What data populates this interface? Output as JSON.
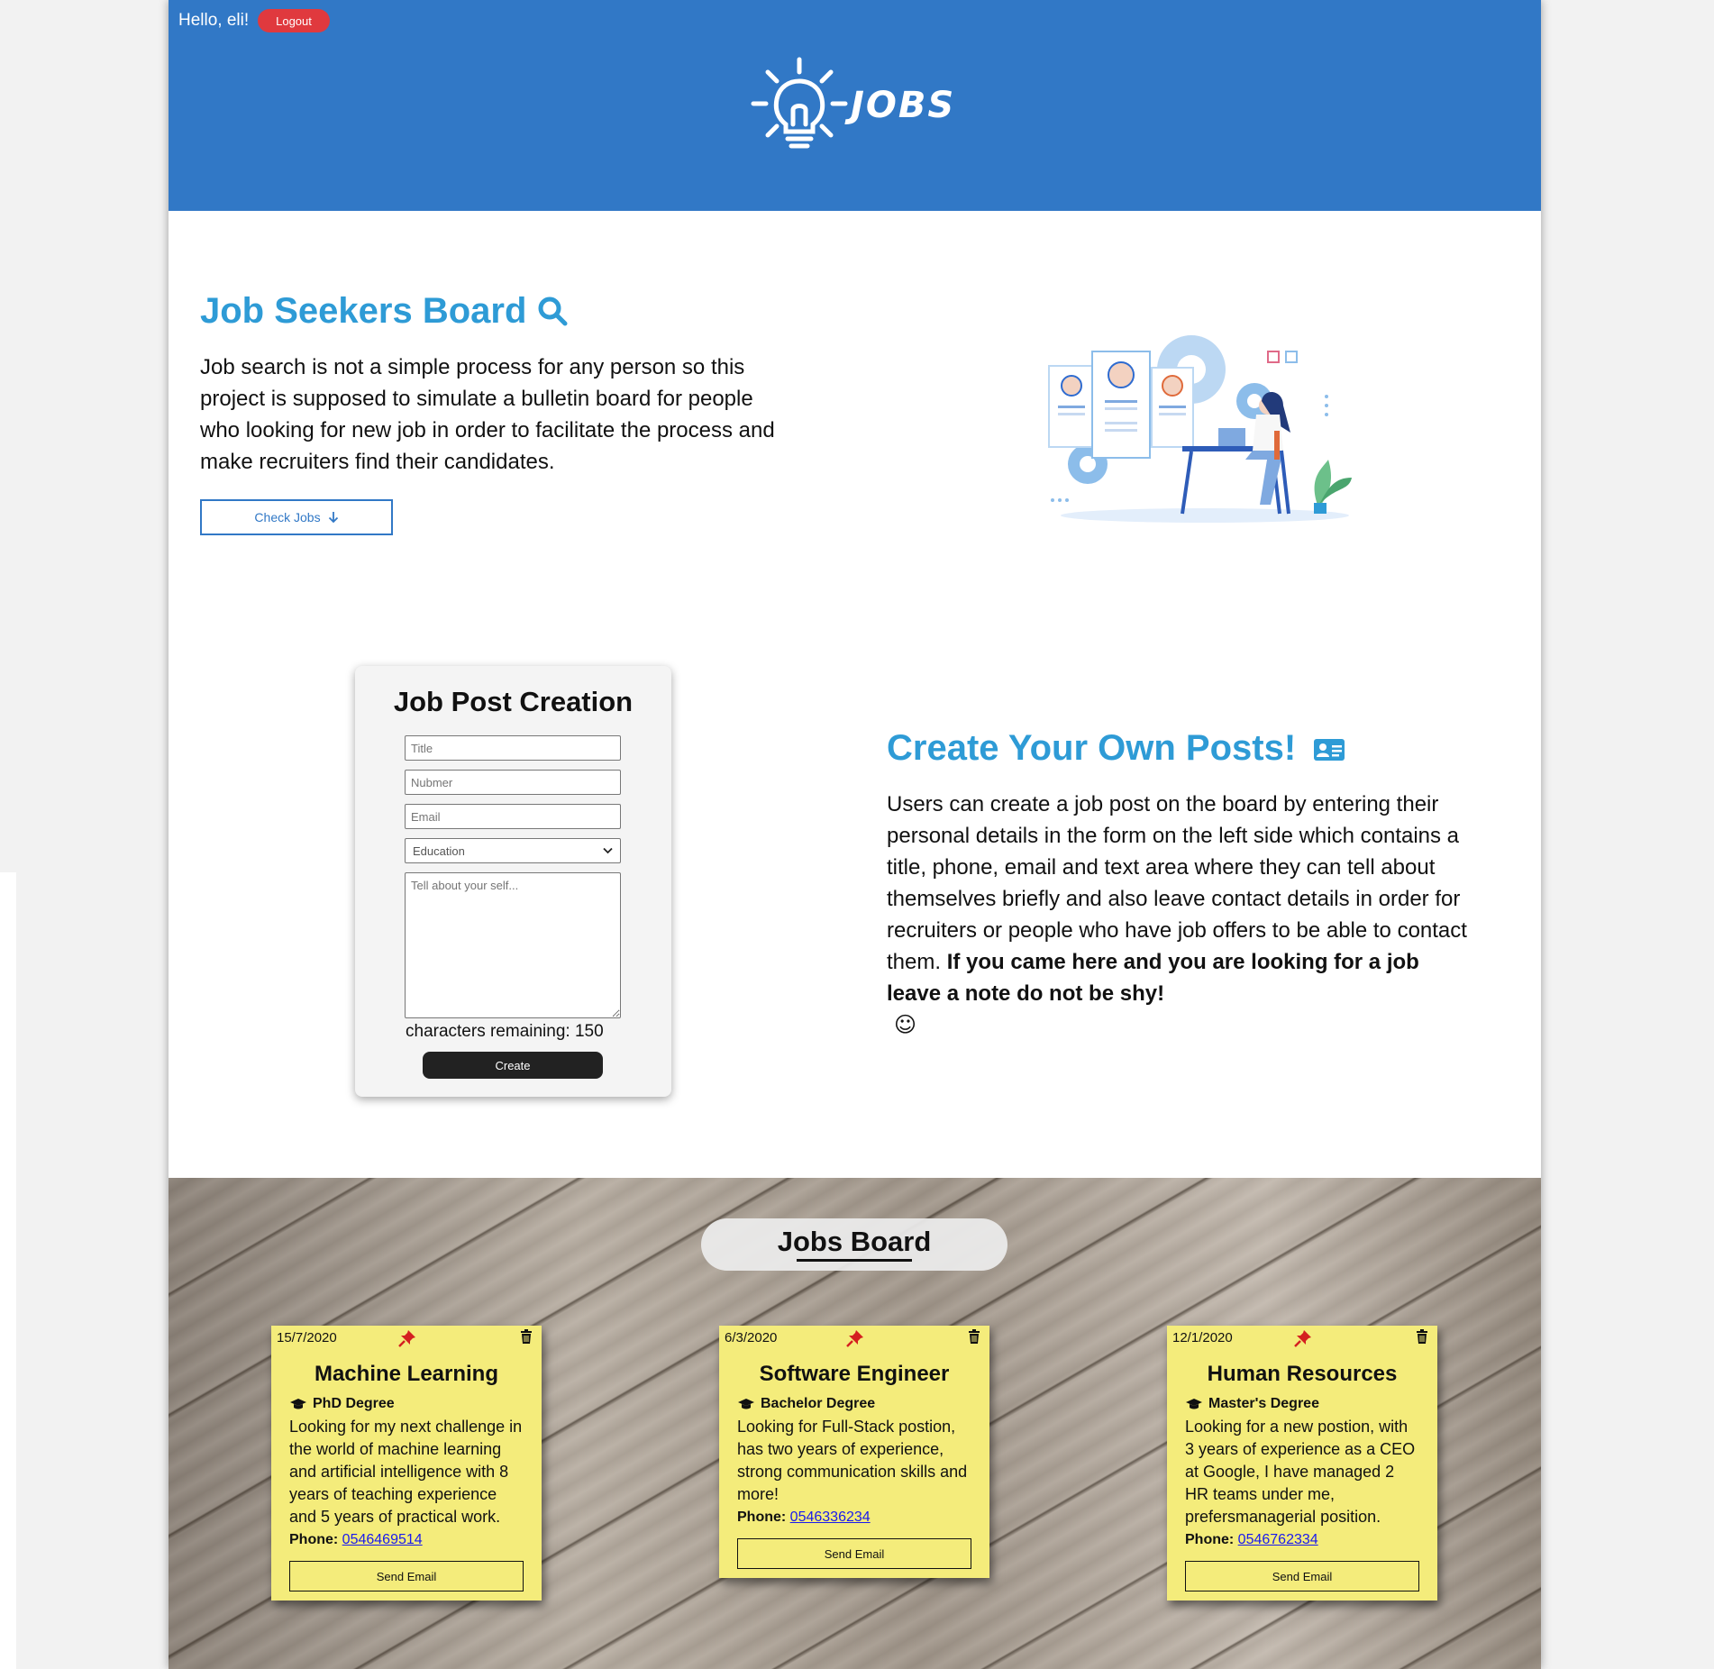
{
  "header": {
    "greeting": "Hello, eli!",
    "logout_label": "Logout",
    "logo_text": "JOBS",
    "color": "#3178c6"
  },
  "intro": {
    "title": "Job Seekers Board",
    "text": "Job search is not a simple process for any person so this project is supposed to simulate a bulletin board for people who looking for new job in order to facilitate the process and make recruiters find their candidates.",
    "check_button": "Check Jobs"
  },
  "form": {
    "title": "Job Post Creation",
    "title_placeholder": "Title",
    "number_placeholder": "Nubmer",
    "email_placeholder": "Email",
    "education_selected": "Education",
    "about_placeholder": "Tell about your self...",
    "chars_remaining": "characters remaining: 150",
    "create_label": "Create"
  },
  "own_posts": {
    "title": "Create Your Own Posts!",
    "text": "Users can create a job post on the board by entering their personal details in the form on the left side which contains a title, phone, email and text area where they can tell about themselves briefly and also leave contact details in order for recruiters or people who have job offers to be able to contact them.",
    "bold_text": "If you came here and you are looking for a job leave a note do not be shy!",
    "emoji": "☺"
  },
  "board": {
    "title": "Jobs Board",
    "notes": [
      {
        "date": "15/7/2020",
        "title": "Machine Learning",
        "degree": "PhD Degree",
        "description": "Looking for my next challenge in the world of machine learning and artificial intelligence with 8 years of teaching experience and 5 years of practical work.",
        "phone_label": "Phone:",
        "phone": "0546469514",
        "send_label": "Send Email"
      },
      {
        "date": "6/3/2020",
        "title": "Software Engineer",
        "degree": "Bachelor Degree",
        "description": "Looking for Full-Stack postion, has two years of experience, strong communication skills and more!",
        "phone_label": "Phone:",
        "phone": "0546336234",
        "send_label": "Send Email"
      },
      {
        "date": "12/1/2020",
        "title": "Human Resources",
        "degree": "Master's Degree",
        "description": "Looking for a new postion, with 3 years of experience as a CEO at Google, I have managed 2 HR teams under me, prefersmanagerial position.",
        "phone_label": "Phone:",
        "phone": "0546762334",
        "send_label": "Send Email"
      }
    ]
  },
  "colors": {
    "accent_blue": "#2e9bd6",
    "note_yellow": "#f4ec7b",
    "logout_red": "#e0393e"
  }
}
